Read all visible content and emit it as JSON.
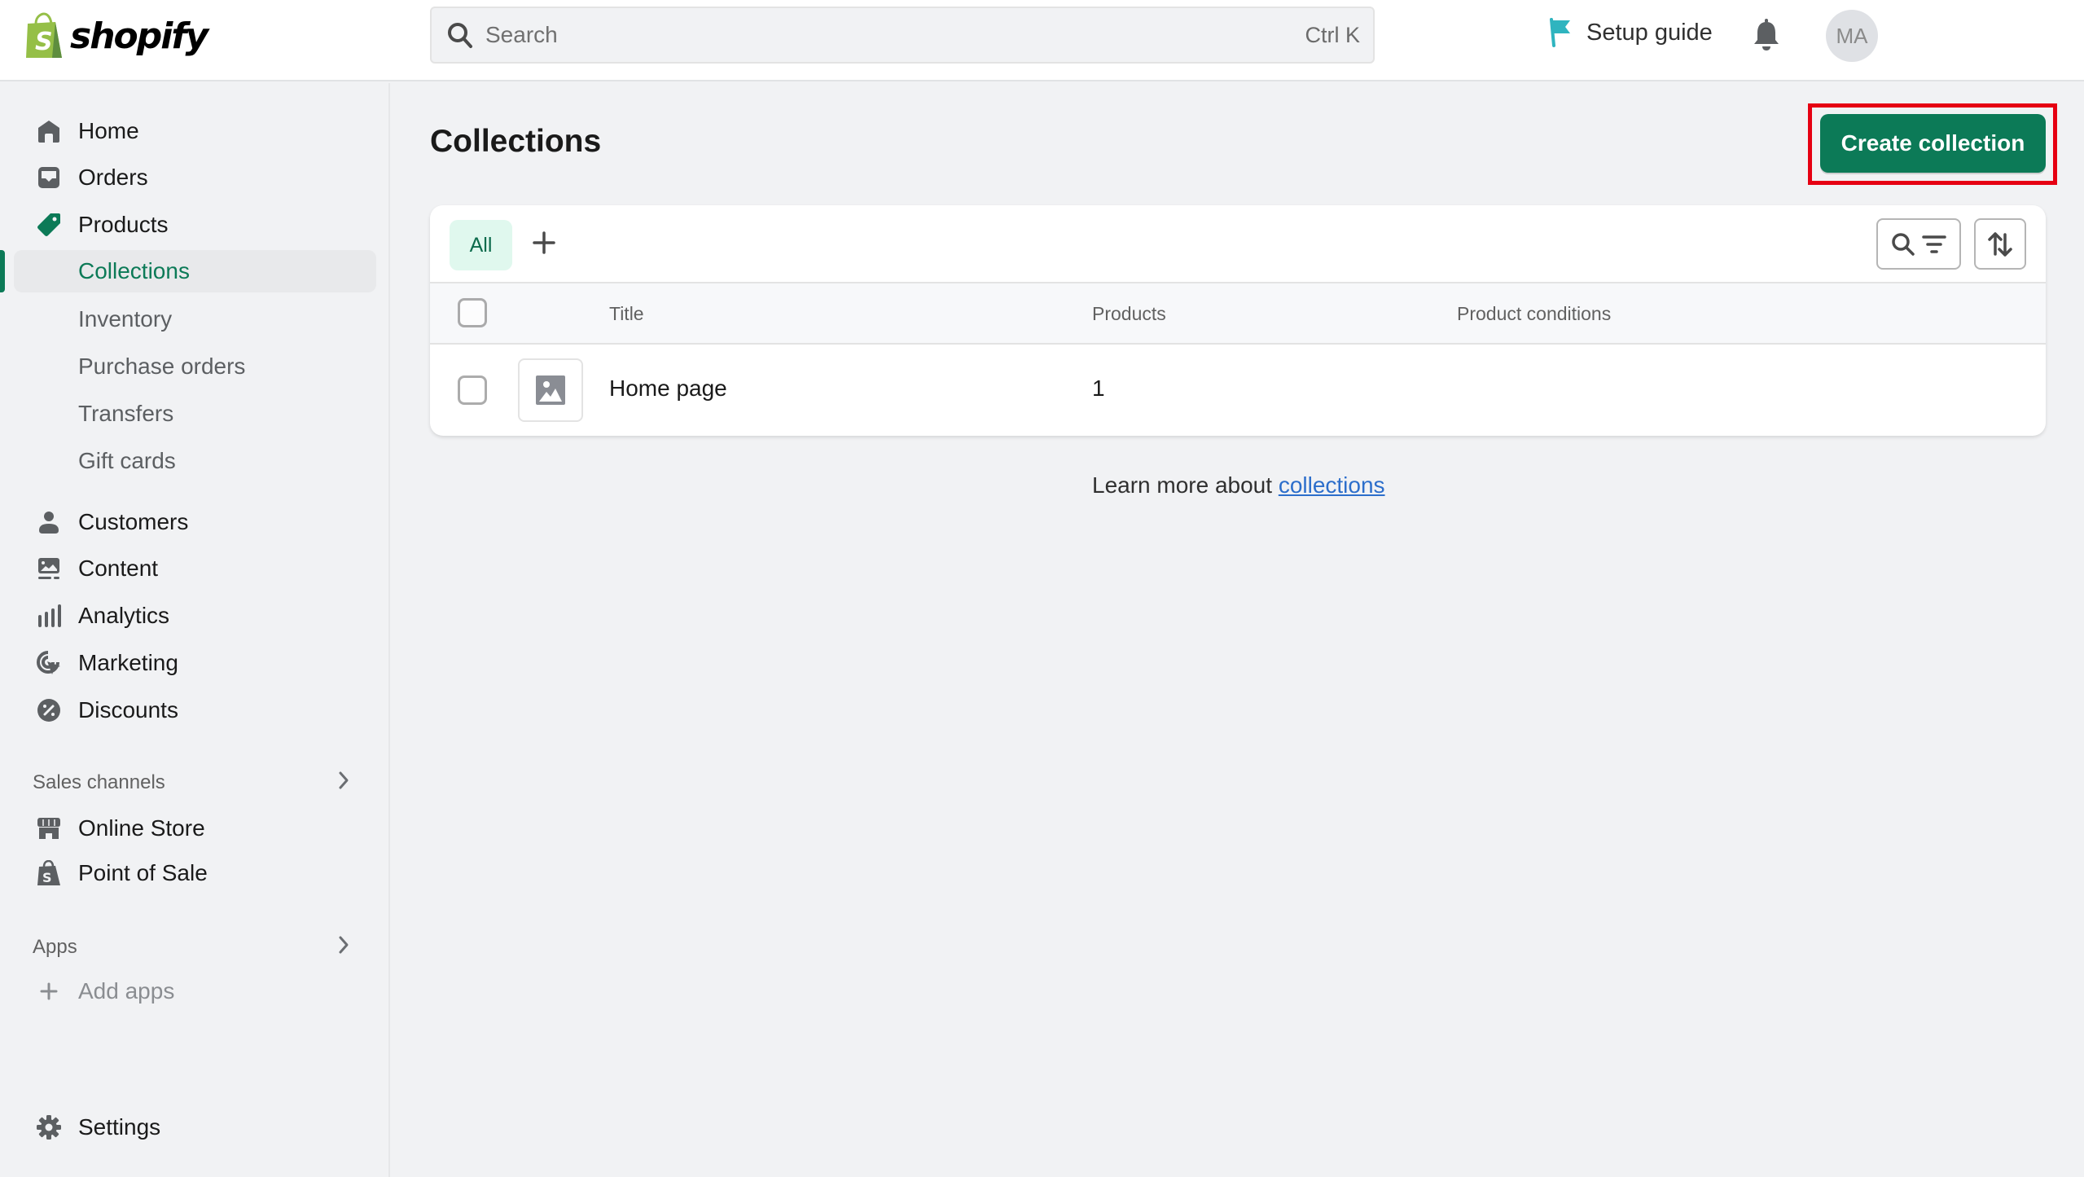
{
  "app": {
    "brand": "shopify",
    "accent_color": "#0c7a57",
    "highlight_color": "#e60012"
  },
  "topbar": {
    "search": {
      "placeholder": "Search",
      "value": "",
      "shortcut": "Ctrl K"
    },
    "setup_guide_label": "Setup guide",
    "avatar_initials": "MA"
  },
  "sidebar": {
    "items": [
      {
        "label": "Home",
        "icon": "home-icon"
      },
      {
        "label": "Orders",
        "icon": "inbox-icon"
      },
      {
        "label": "Products",
        "icon": "tag-icon"
      },
      {
        "label": "Collections",
        "active": true
      },
      {
        "label": "Inventory"
      },
      {
        "label": "Purchase orders"
      },
      {
        "label": "Transfers"
      },
      {
        "label": "Gift cards"
      },
      {
        "label": "Customers",
        "icon": "person-icon"
      },
      {
        "label": "Content",
        "icon": "image-icon"
      },
      {
        "label": "Analytics",
        "icon": "bar-chart-icon"
      },
      {
        "label": "Marketing",
        "icon": "target-icon"
      },
      {
        "label": "Discounts",
        "icon": "discount-icon"
      }
    ],
    "sales_channels": {
      "label": "Sales channels",
      "items": [
        {
          "label": "Online Store",
          "icon": "store-icon"
        },
        {
          "label": "Point of Sale",
          "icon": "shopify-bag-icon"
        }
      ]
    },
    "apps": {
      "label": "Apps",
      "add_label": "Add apps"
    },
    "settings_label": "Settings"
  },
  "main": {
    "title": "Collections",
    "create_button": "Create collection",
    "tabs": [
      {
        "label": "All",
        "selected": true
      }
    ],
    "table": {
      "columns": [
        "Title",
        "Products",
        "Product conditions"
      ],
      "rows": [
        {
          "title": "Home page",
          "products": "1",
          "conditions": ""
        }
      ]
    },
    "learn_more": {
      "prefix": "Learn more about ",
      "link": "collections"
    }
  }
}
